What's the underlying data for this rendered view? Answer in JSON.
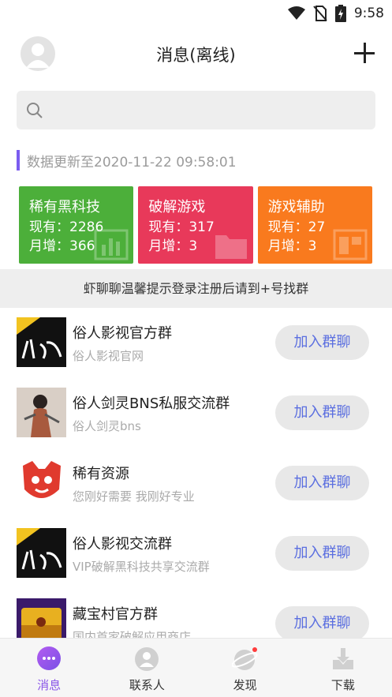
{
  "status_bar": {
    "time": "9:58"
  },
  "header": {
    "title": "消息(离线)"
  },
  "search": {
    "placeholder": ""
  },
  "update": {
    "text": "数据更新至2020-11-22 09:58:01"
  },
  "cards": [
    {
      "title": "稀有黑科技",
      "current": "现有：2286",
      "monthly": "月增：366",
      "color": "#4caf3a"
    },
    {
      "title": "破解游戏",
      "current": "现有：317",
      "monthly": "月增：3",
      "color": "#e8395a"
    },
    {
      "title": "游戏辅助",
      "current": "现有：27",
      "monthly": "月增：3",
      "color": "#f97a1e"
    }
  ],
  "tip": {
    "text": "虾聊聊温馨提示登录注册后请到+号找群"
  },
  "groups": [
    {
      "name": "俗人影视官方群",
      "desc": "俗人影视官网",
      "join": "加入群聊"
    },
    {
      "name": "俗人剑灵BNS私服交流群",
      "desc": "俗人剑灵bns",
      "join": "加入群聊"
    },
    {
      "name": "稀有资源",
      "desc": "您刚好需要 我刚好专业",
      "join": "加入群聊"
    },
    {
      "name": "俗人影视交流群",
      "desc": "VIP破解黑科技共享交流群",
      "join": "加入群聊"
    },
    {
      "name": "藏宝村官方群",
      "desc": "国内首家破解应用商店",
      "join": "加入群聊"
    }
  ],
  "bottom_nav": [
    {
      "label": "消息",
      "icon": "chat-bubble-icon",
      "active": true
    },
    {
      "label": "联系人",
      "icon": "contacts-icon",
      "active": false
    },
    {
      "label": "发现",
      "icon": "planet-icon",
      "active": false
    },
    {
      "label": "下载",
      "icon": "download-icon",
      "active": false
    }
  ],
  "colors": {
    "accent": "#8a55e8",
    "join_text": "#5a6ee0",
    "notification_dot": "#ff3b3b"
  }
}
